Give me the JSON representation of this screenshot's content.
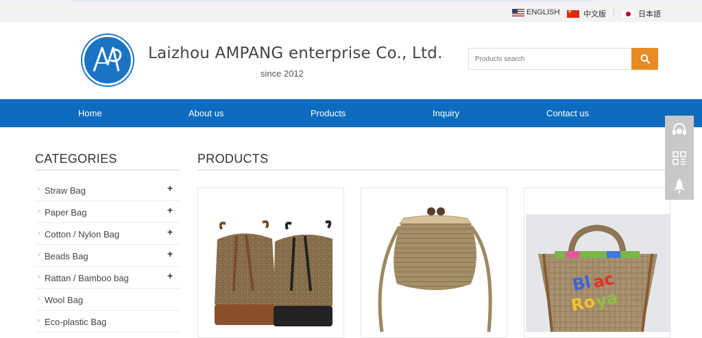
{
  "languages": [
    {
      "label": "ENGLISH",
      "flag": "us-flag-icon"
    },
    {
      "label": "中文版",
      "flag": "china-flag-icon"
    },
    {
      "label": "日本語",
      "flag": "japan-flag-icon"
    }
  ],
  "header": {
    "logo_text": "AMP",
    "company_name": "Laizhou AMPANG enterprise Co., Ltd.",
    "since": "since 2012"
  },
  "search": {
    "placeholder": "Products search",
    "icon": "search-icon"
  },
  "nav": {
    "items": [
      {
        "label": "Home"
      },
      {
        "label": "About us"
      },
      {
        "label": "Products"
      },
      {
        "label": "Inquiry"
      },
      {
        "label": "Contact us"
      }
    ]
  },
  "sidebar": {
    "title": "CATEGORIES",
    "items": [
      {
        "label": "Straw Bag",
        "expandable": true
      },
      {
        "label": "Paper Bag",
        "expandable": true
      },
      {
        "label": "Cotton / Nylon Bag",
        "expandable": true
      },
      {
        "label": "Beads Bag",
        "expandable": true
      },
      {
        "label": "Rattan / Bamboo bag",
        "expandable": true
      },
      {
        "label": "Wool Bag",
        "expandable": false
      },
      {
        "label": "Eco-plastic Bag",
        "expandable": false
      }
    ],
    "expand_symbol": "+",
    "arrow_symbol": "›"
  },
  "main": {
    "title": "PRODUCTS",
    "products": [
      {
        "image": "straw-bucket-bags-image"
      },
      {
        "image": "straw-clutch-shoulder-bag-image"
      },
      {
        "image": "straw-tote-embroidered-bag-image"
      }
    ]
  },
  "side_tools": [
    "headset-icon",
    "qr-code-icon",
    "rocket-icon"
  ],
  "colors": {
    "nav_blue": "#0d6cbf",
    "search_orange": "#e98b25",
    "logo_blue": "#1a74c4"
  }
}
